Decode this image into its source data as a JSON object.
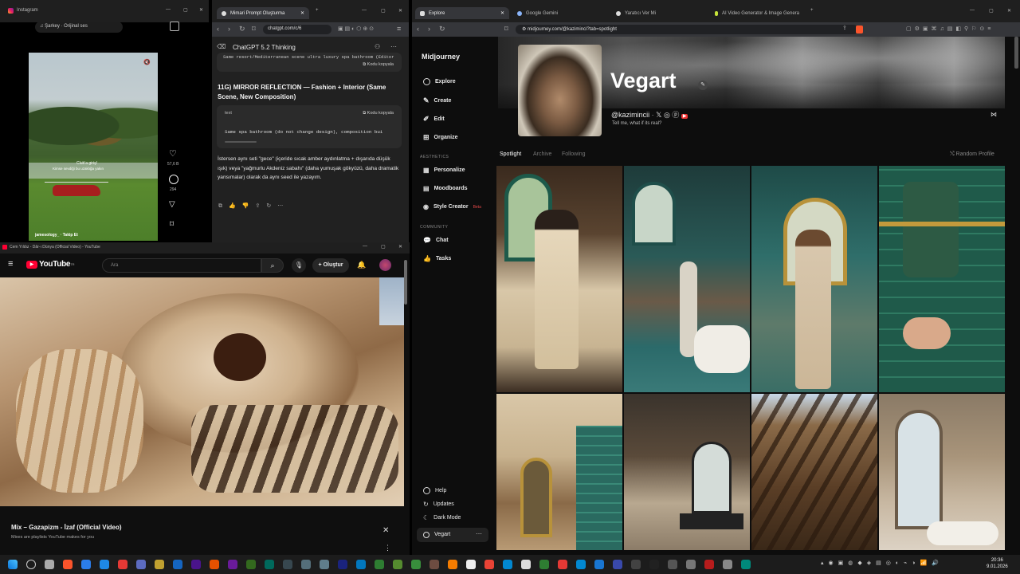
{
  "instagram": {
    "tab_title": "Instagram",
    "audio": "Şarkey · Orijinal ses",
    "like_count": "57,6 B",
    "comment_count": "294",
    "overlay_caption_1": "Club'a giriş!",
    "overlay_caption_2": "Kimse sevdiği bu uzaklığa yakın",
    "user": "jamesology_ · Takip Et"
  },
  "chatgpt": {
    "tab_title": "Mimari Prompt Oluşturma",
    "url": "chatgpt.com/c/6",
    "model": "ChatGPT 5.2 Thinking",
    "copy_label": "Kodu kopyala",
    "top_code_line": "Same resort/Mediterranean scene ultra luxury spa bathroom (Editor",
    "heading": "11G) MIRROR REFLECTION — Fashion + Interior (Same Scene, New Composition)",
    "code_lang": "text",
    "code_line": "Same spa bathroom (do not change design), composition bui",
    "paragraph": "İstersen aynı seti \"gece\" (içeride sıcak amber aydınlatma + dışarıda düşük ışık) veya \"yağmurlu Akdeniz sabahı\" (daha yumuşak gökyüzü, daha dramatik yansımalar) olarak da aynı seed ile yazayım."
  },
  "youtube": {
    "window_title": "Cem Yıldız - Dâr-ı Dünya (Official Video) - YouTube",
    "logo": "YouTube",
    "logo_sup": "TR",
    "search_placeholder": "Ara",
    "create_label": "Oluştur",
    "mix_title": "Mix – Gazapizm - İzaf (Official Video)",
    "mix_sub": "Mixes are playlists YouTube makes for you"
  },
  "midjourney": {
    "tabs": [
      "Explore",
      "Google Gemini",
      "Yaratıcı Ver Mi",
      "AI Video Generator & Image Genera"
    ],
    "url": "midjourney.com/@kaziminci?tab=spotlight",
    "brand": "Midjourney",
    "nav": [
      "Explore",
      "Create",
      "Edit",
      "Organize"
    ],
    "aesthetics_header": "AESTHETICS",
    "aesthetics": [
      "Personalize",
      "Moodboards",
      "Style Creator"
    ],
    "beta_badge": "Beta",
    "community_header": "COMMUNITY",
    "community": [
      "Chat",
      "Tasks"
    ],
    "bottom": [
      "Help",
      "Updates",
      "Dark Mode"
    ],
    "user": "Vegart",
    "profile_name": "Vegart",
    "handle": "@kazimincii",
    "bio": "Tell me, what if its real?",
    "profile_tabs": [
      "Spotlight",
      "Archive",
      "Following"
    ],
    "random_profile": "Random Profile"
  },
  "taskbar": {
    "time": "20:36",
    "date": "9.01.2026"
  },
  "colors": {
    "accent_red": "#ff0033",
    "beta_red": "#e34848",
    "taskbar": "#1c1c1c"
  }
}
